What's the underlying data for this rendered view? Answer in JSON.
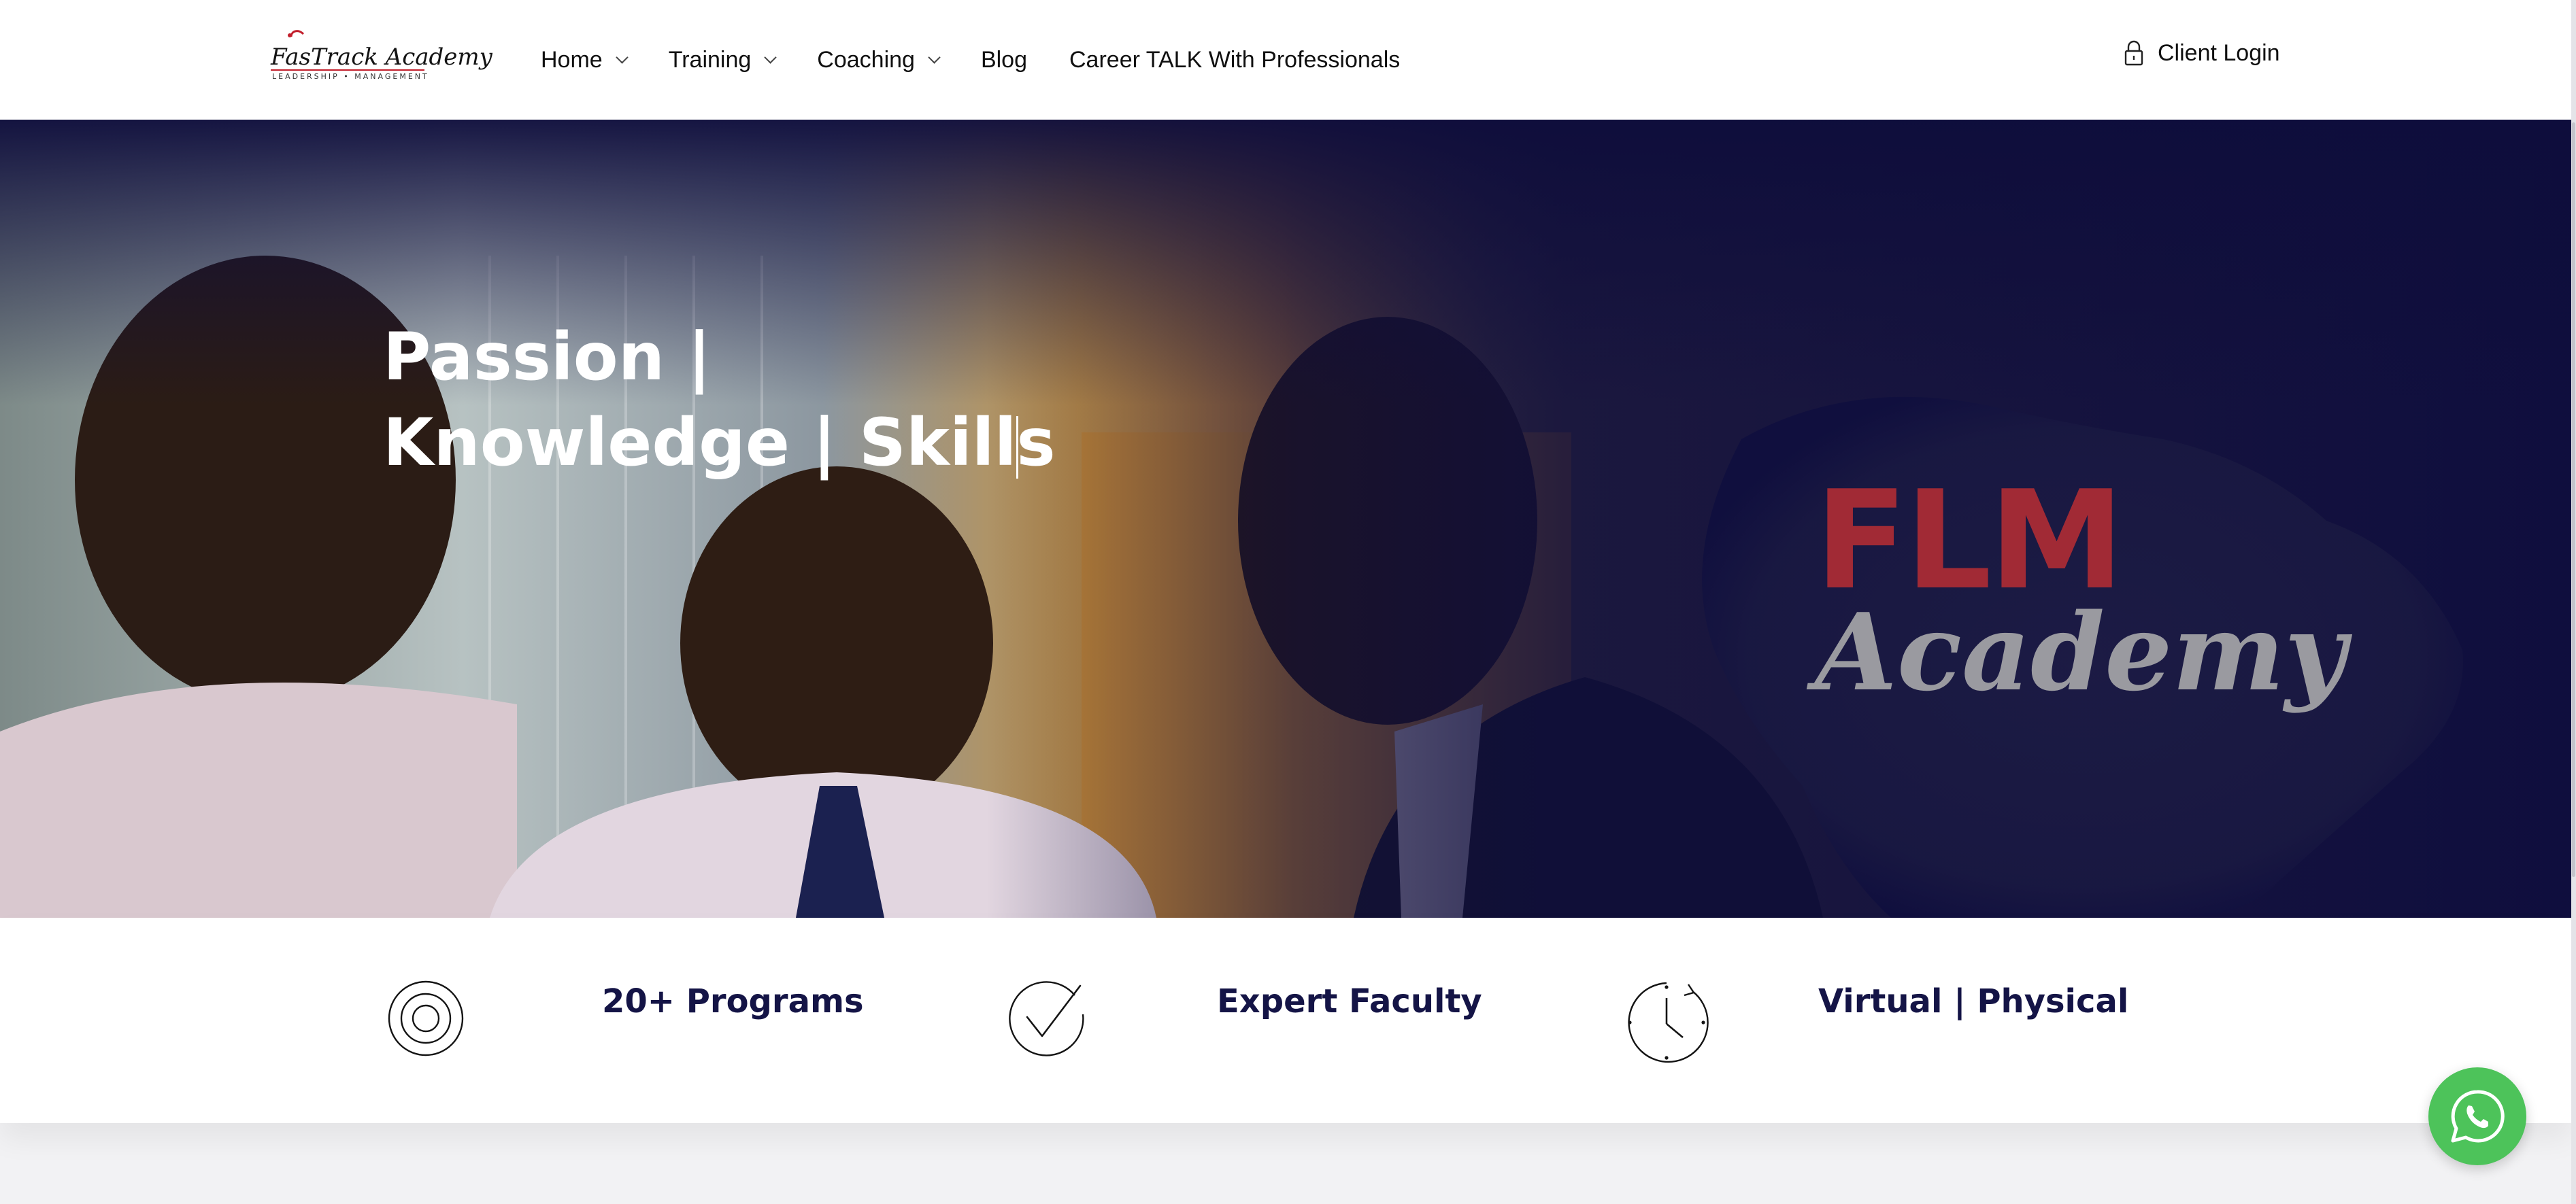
{
  "header": {
    "logo": {
      "name": "FasTrack Academy",
      "tagline": "LEADERSHIP • MANAGEMENT"
    },
    "nav": [
      {
        "label": "Home",
        "has_dropdown": true
      },
      {
        "label": "Training",
        "has_dropdown": true
      },
      {
        "label": "Coaching",
        "has_dropdown": true
      },
      {
        "label": "Blog",
        "has_dropdown": false
      },
      {
        "label": "Career TALK With Professionals",
        "has_dropdown": false
      }
    ],
    "login": {
      "label": "Client Login",
      "icon": "lock-icon"
    }
  },
  "hero": {
    "title_line1": "Passion |",
    "title_line2": "Knowledge | Skills",
    "badge": {
      "line1": "FLM",
      "line2": "Academy"
    }
  },
  "features": [
    {
      "label": "20+ Programs",
      "icon": "target-icon"
    },
    {
      "label": "Expert Faculty",
      "icon": "checkmark-circle-icon"
    },
    {
      "label": "Virtual | Physical",
      "icon": "clock-refresh-icon"
    }
  ],
  "whatsapp": {
    "icon": "whatsapp-icon"
  },
  "colors": {
    "navy": "#141446",
    "hero_overlay": "#0e0d3c",
    "accent_red": "#c21f2c",
    "whatsapp_green": "#4dc35a"
  }
}
